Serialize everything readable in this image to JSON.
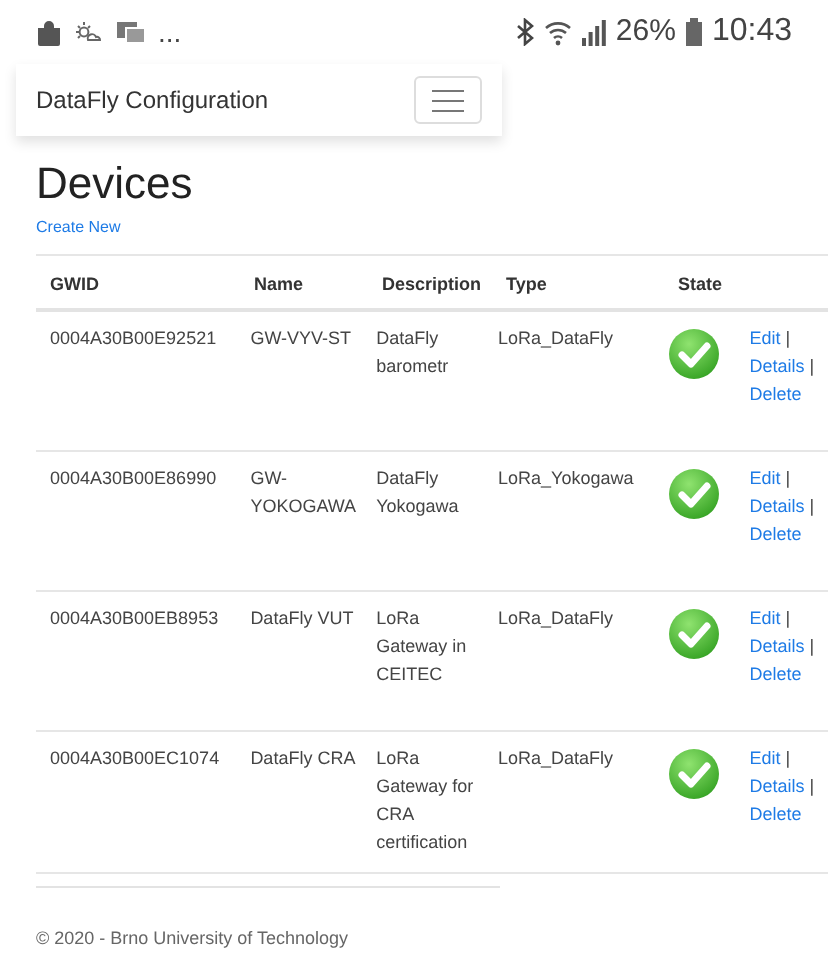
{
  "status_bar": {
    "more": "...",
    "battery": "26%",
    "time": "10:43"
  },
  "navbar": {
    "brand": "DataFly Configuration"
  },
  "page": {
    "title": "Devices",
    "create_link": "Create New"
  },
  "table": {
    "columns": [
      "GWID",
      "Name",
      "Description",
      "Type",
      "State"
    ],
    "rows": [
      {
        "gwid": "0004A30B00E92521",
        "name": "GW-VYV-ST",
        "description": "DataFly barometr",
        "type": "LoRa_DataFly",
        "active": true,
        "actions": [
          {
            "kind": "link",
            "text": "Edit"
          },
          {
            "kind": "separator",
            "text": "|"
          },
          {
            "kind": "link",
            "text": "Details"
          },
          {
            "kind": "separator",
            "text": "|"
          },
          {
            "kind": "link",
            "text": "Delete"
          }
        ]
      },
      {
        "gwid": "0004A30B00E86990",
        "name": "GW-YOKOGAWA",
        "description": "DataFly Yokogawa",
        "type": "LoRa_Yokogawa",
        "active": true,
        "actions": [
          {
            "kind": "link",
            "text": "Edit"
          },
          {
            "kind": "separator",
            "text": "|"
          },
          {
            "kind": "link",
            "text": "Details"
          },
          {
            "kind": "separator",
            "text": "|"
          },
          {
            "kind": "link",
            "text": "Delete"
          }
        ]
      },
      {
        "gwid": "0004A30B00EB8953",
        "name": "DataFly VUT",
        "description": "LoRa Gateway in CEITEC",
        "type": "LoRa_DataFly",
        "active": true,
        "actions": [
          {
            "kind": "link",
            "text": "Edit"
          },
          {
            "kind": "separator",
            "text": "|"
          },
          {
            "kind": "link",
            "text": "Details"
          },
          {
            "kind": "separator",
            "text": "|"
          },
          {
            "kind": "link",
            "text": "Delete"
          }
        ]
      },
      {
        "gwid": "0004A30B00EC1074",
        "name": "DataFly CRA",
        "description": "LoRa Gateway for CRA certification",
        "type": "LoRa_DataFly",
        "active": true,
        "actions": [
          {
            "kind": "link",
            "text": "Edit"
          },
          {
            "kind": "separator",
            "text": "|"
          },
          {
            "kind": "link",
            "text": "Details"
          },
          {
            "kind": "separator",
            "text": "|"
          },
          {
            "kind": "link",
            "text": "Delete"
          }
        ]
      }
    ]
  },
  "footer": "© 2020 - Brno University of Technology"
}
